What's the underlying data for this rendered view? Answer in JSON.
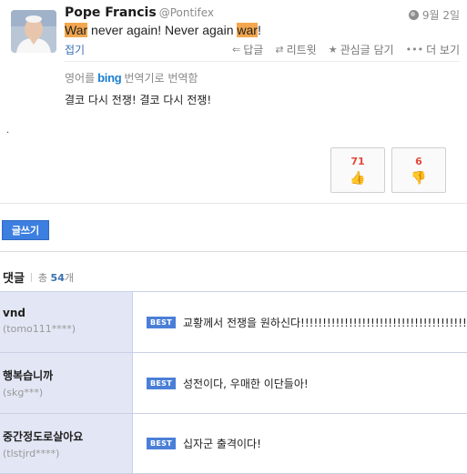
{
  "tweet": {
    "name": "Pope Francis",
    "handle": "@Pontifex",
    "date": "9월 2일",
    "text_parts": {
      "w1": "War",
      "t1": " never again! Never again ",
      "w2": "war",
      "t2": "!"
    },
    "collapse_label": "접기",
    "actions": {
      "reply": "답글",
      "retweet": "리트윗",
      "favorite": "관심글 담기",
      "more": "더 보기"
    },
    "translate_prefix": "영어를",
    "translate_brand": "bing",
    "translate_suffix": "번역기로 번역함",
    "translated_text": "결코 다시 전쟁! 결코 다시 전쟁!"
  },
  "votes": {
    "up": "71",
    "down": "6"
  },
  "write_button_label": "글쓰기",
  "comments": {
    "title": "댓글",
    "total_label": "총",
    "count": "54",
    "unit": "개",
    "items": [
      {
        "nick": "vnd",
        "user_id": "(tomo111****)",
        "badge": "BEST",
        "text": "교황께서 전쟁을 원하신다!!!!!!!!!!!!!!!!!!!!!!!!!!!!!!!!!!!!!!!!!!!"
      },
      {
        "nick": "행복습니까",
        "user_id": "(skg***)",
        "badge": "BEST",
        "text": "성전이다, 우매한 이단들아!"
      },
      {
        "nick": "중간정도로살아요",
        "user_id": "(tlstjrd****)",
        "badge": "BEST",
        "text": "십자군 출격이다!"
      }
    ]
  },
  "colors": {
    "highlight": "#f3a64e",
    "accent_blue": "#3c7fe0",
    "comment_user_bg": "#e3e7f5",
    "vote_count_red": "#e24a3b"
  }
}
